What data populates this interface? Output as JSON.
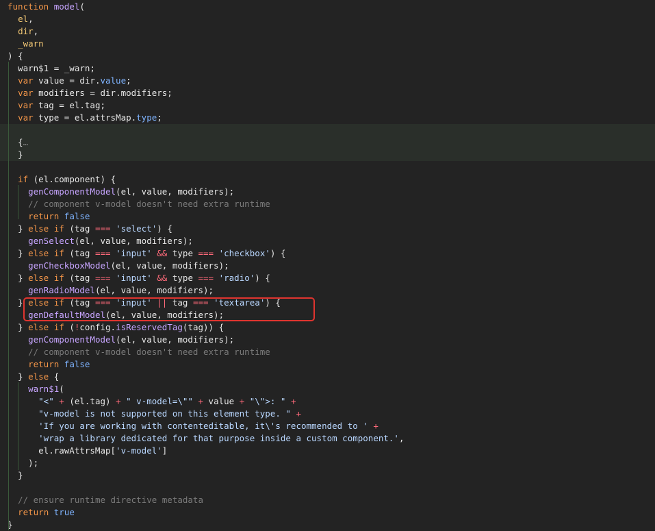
{
  "editor": {
    "lines": [
      [
        [
          "kw",
          "function"
        ],
        [
          "pl",
          " "
        ],
        [
          "fn",
          "model"
        ],
        [
          "pl",
          "("
        ]
      ],
      [
        [
          "pl",
          "  "
        ],
        [
          "param",
          "el"
        ],
        [
          "pl",
          ","
        ]
      ],
      [
        [
          "pl",
          "  "
        ],
        [
          "param",
          "dir"
        ],
        [
          "pl",
          ","
        ]
      ],
      [
        [
          "pl",
          "  "
        ],
        [
          "param",
          "_warn"
        ]
      ],
      [
        [
          "pl",
          ") {"
        ]
      ],
      [
        [
          "pl",
          "  warn$1 = _warn;"
        ]
      ],
      [
        [
          "pl",
          "  "
        ],
        [
          "kw",
          "var"
        ],
        [
          "pl",
          " value = dir."
        ],
        [
          "prop",
          "value"
        ],
        [
          "pl",
          ";"
        ]
      ],
      [
        [
          "pl",
          "  "
        ],
        [
          "kw",
          "var"
        ],
        [
          "pl",
          " modifiers = dir.modifiers;"
        ]
      ],
      [
        [
          "pl",
          "  "
        ],
        [
          "kw",
          "var"
        ],
        [
          "pl",
          " tag = el.tag;"
        ]
      ],
      [
        [
          "pl",
          "  "
        ],
        [
          "kw",
          "var"
        ],
        [
          "pl",
          " type = el.attrsMap."
        ],
        [
          "prop",
          "type"
        ],
        [
          "pl",
          ";"
        ]
      ],
      [
        [
          "pl",
          ""
        ]
      ],
      [
        [
          "pl",
          "  {"
        ],
        [
          "fold",
          "…"
        ]
      ],
      [
        [
          "pl",
          "  }"
        ]
      ],
      [
        [
          "pl",
          ""
        ]
      ],
      [
        [
          "pl",
          "  "
        ],
        [
          "kw",
          "if"
        ],
        [
          "pl",
          " (el.component) {"
        ]
      ],
      [
        [
          "pl",
          "    "
        ],
        [
          "fn",
          "genComponentModel"
        ],
        [
          "pl",
          "(el, value, modifiers);"
        ]
      ],
      [
        [
          "pl",
          "    "
        ],
        [
          "cmt",
          "// component v-model doesn't need extra runtime"
        ]
      ],
      [
        [
          "pl",
          "    "
        ],
        [
          "kw",
          "return"
        ],
        [
          "pl",
          " "
        ],
        [
          "lit",
          "false"
        ]
      ],
      [
        [
          "pl",
          "  } "
        ],
        [
          "kw",
          "else if"
        ],
        [
          "pl",
          " (tag "
        ],
        [
          "op",
          "==="
        ],
        [
          "pl",
          " "
        ],
        [
          "str",
          "'select'"
        ],
        [
          "pl",
          ") {"
        ]
      ],
      [
        [
          "pl",
          "    "
        ],
        [
          "fn",
          "genSelect"
        ],
        [
          "pl",
          "(el, value, modifiers);"
        ]
      ],
      [
        [
          "pl",
          "  } "
        ],
        [
          "kw",
          "else if"
        ],
        [
          "pl",
          " (tag "
        ],
        [
          "op",
          "==="
        ],
        [
          "pl",
          " "
        ],
        [
          "str",
          "'input'"
        ],
        [
          "pl",
          " "
        ],
        [
          "op",
          "&&"
        ],
        [
          "pl",
          " type "
        ],
        [
          "op",
          "==="
        ],
        [
          "pl",
          " "
        ],
        [
          "str",
          "'checkbox'"
        ],
        [
          "pl",
          ") {"
        ]
      ],
      [
        [
          "pl",
          "    "
        ],
        [
          "fn",
          "genCheckboxModel"
        ],
        [
          "pl",
          "(el, value, modifiers);"
        ]
      ],
      [
        [
          "pl",
          "  } "
        ],
        [
          "kw",
          "else if"
        ],
        [
          "pl",
          " (tag "
        ],
        [
          "op",
          "==="
        ],
        [
          "pl",
          " "
        ],
        [
          "str",
          "'input'"
        ],
        [
          "pl",
          " "
        ],
        [
          "op",
          "&&"
        ],
        [
          "pl",
          " type "
        ],
        [
          "op",
          "==="
        ],
        [
          "pl",
          " "
        ],
        [
          "str",
          "'radio'"
        ],
        [
          "pl",
          ") {"
        ]
      ],
      [
        [
          "pl",
          "    "
        ],
        [
          "fn",
          "genRadioModel"
        ],
        [
          "pl",
          "(el, value, modifiers);"
        ]
      ],
      [
        [
          "pl",
          "  } "
        ],
        [
          "kw",
          "else if"
        ],
        [
          "pl",
          " (tag "
        ],
        [
          "op",
          "==="
        ],
        [
          "pl",
          " "
        ],
        [
          "str",
          "'input'"
        ],
        [
          "pl",
          " "
        ],
        [
          "op",
          "||"
        ],
        [
          "pl",
          " tag "
        ],
        [
          "op",
          "==="
        ],
        [
          "pl",
          " "
        ],
        [
          "str",
          "'textarea'"
        ],
        [
          "pl",
          ") {"
        ]
      ],
      [
        [
          "pl",
          "    "
        ],
        [
          "fn",
          "genDefaultModel"
        ],
        [
          "pl",
          "(el, value, modifiers);"
        ]
      ],
      [
        [
          "pl",
          "  } "
        ],
        [
          "kw",
          "else if"
        ],
        [
          "pl",
          " ("
        ],
        [
          "op",
          "!"
        ],
        [
          "pl",
          "config."
        ],
        [
          "fn",
          "isReservedTag"
        ],
        [
          "pl",
          "(tag)) {"
        ]
      ],
      [
        [
          "pl",
          "    "
        ],
        [
          "fn",
          "genComponentModel"
        ],
        [
          "pl",
          "(el, value, modifiers);"
        ]
      ],
      [
        [
          "pl",
          "    "
        ],
        [
          "cmt",
          "// component v-model doesn't need extra runtime"
        ]
      ],
      [
        [
          "pl",
          "    "
        ],
        [
          "kw",
          "return"
        ],
        [
          "pl",
          " "
        ],
        [
          "lit",
          "false"
        ]
      ],
      [
        [
          "pl",
          "  } "
        ],
        [
          "kw",
          "else"
        ],
        [
          "pl",
          " {"
        ]
      ],
      [
        [
          "pl",
          "    "
        ],
        [
          "fn",
          "warn$1"
        ],
        [
          "pl",
          "("
        ]
      ],
      [
        [
          "pl",
          "      "
        ],
        [
          "str",
          "\"<\""
        ],
        [
          "pl",
          " "
        ],
        [
          "op",
          "+"
        ],
        [
          "pl",
          " (el.tag) "
        ],
        [
          "op",
          "+"
        ],
        [
          "pl",
          " "
        ],
        [
          "str",
          "\" v-model=\\\"\""
        ],
        [
          "pl",
          " "
        ],
        [
          "op",
          "+"
        ],
        [
          "pl",
          " value "
        ],
        [
          "op",
          "+"
        ],
        [
          "pl",
          " "
        ],
        [
          "str",
          "\"\\\">: \""
        ],
        [
          "pl",
          " "
        ],
        [
          "op",
          "+"
        ]
      ],
      [
        [
          "pl",
          "      "
        ],
        [
          "str",
          "\"v-model is not supported on this element type. \""
        ],
        [
          "pl",
          " "
        ],
        [
          "op",
          "+"
        ]
      ],
      [
        [
          "pl",
          "      "
        ],
        [
          "str",
          "'If you are working with contenteditable, it\\'s recommended to '"
        ],
        [
          "pl",
          " "
        ],
        [
          "op",
          "+"
        ]
      ],
      [
        [
          "pl",
          "      "
        ],
        [
          "str",
          "'wrap a library dedicated for that purpose inside a custom component.'"
        ],
        [
          "pl",
          ","
        ]
      ],
      [
        [
          "pl",
          "      el.rawAttrsMap["
        ],
        [
          "str",
          "'v-model'"
        ],
        [
          "pl",
          "]"
        ]
      ],
      [
        [
          "pl",
          "    );"
        ]
      ],
      [
        [
          "pl",
          "  }"
        ]
      ],
      [
        [
          "pl",
          ""
        ]
      ],
      [
        [
          "pl",
          "  "
        ],
        [
          "cmt",
          "// ensure runtime directive metadata"
        ]
      ],
      [
        [
          "pl",
          "  "
        ],
        [
          "kw",
          "return"
        ],
        [
          "pl",
          " "
        ],
        [
          "lit",
          "true"
        ]
      ],
      [
        [
          "pl",
          "}"
        ]
      ]
    ]
  }
}
